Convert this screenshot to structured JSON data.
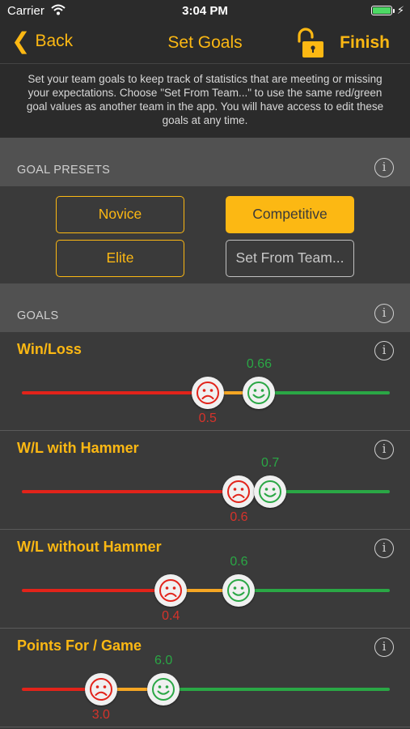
{
  "status_bar": {
    "carrier": "Carrier",
    "time": "3:04 PM",
    "battery_level": 1.0
  },
  "nav": {
    "back_label": "Back",
    "title": "Set Goals",
    "finish_label": "Finish",
    "lock_icon": "unlocked-padlock-icon"
  },
  "description": "Set your team goals to keep track of statistics that are meeting or missing your expectations.  Choose \"Set From Team...\" to use the same red/green goal values as another team in the app.  You will have access to edit these goals at any time.",
  "presets_section": {
    "header": "GOAL PRESETS",
    "buttons": [
      {
        "label": "Novice",
        "state": "outline"
      },
      {
        "label": "Competitive",
        "state": "selected"
      },
      {
        "label": "Elite",
        "state": "outline"
      },
      {
        "label": "Set From Team...",
        "state": "grey"
      }
    ]
  },
  "goals_section": {
    "header": "GOALS",
    "goals": [
      {
        "title": "Win/Loss",
        "red_value": "0.5",
        "green_value": "0.66",
        "red_position": 0.505,
        "green_position": 0.645
      },
      {
        "title": "W/L with Hammer",
        "red_value": "0.6",
        "green_value": "0.7",
        "red_position": 0.59,
        "green_position": 0.675
      },
      {
        "title": "W/L without Hammer",
        "red_value": "0.4",
        "green_value": "0.6",
        "red_position": 0.405,
        "green_position": 0.59
      },
      {
        "title": "Points For / Game",
        "red_value": "3.0",
        "green_value": "6.0",
        "red_position": 0.215,
        "green_position": 0.385
      }
    ]
  },
  "colors": {
    "accent": "#fcb813",
    "red": "#e2231a",
    "orange": "#f5a623",
    "green": "#2aa745",
    "background": "#3a3a3a",
    "bar": "#2b2b2b",
    "section_header": "#515151"
  }
}
